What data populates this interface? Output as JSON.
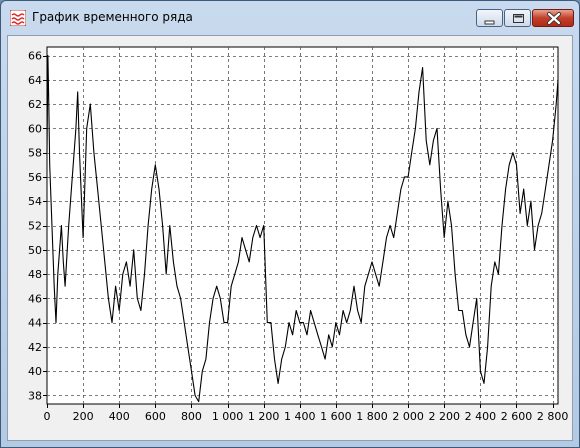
{
  "window": {
    "title": "График временного ряда",
    "icon": "wave-chart-icon",
    "controls": [
      "minimize-icon",
      "maximize-icon",
      "close-icon"
    ]
  },
  "chart_data": {
    "type": "line",
    "title": "",
    "xlabel": "",
    "ylabel": "",
    "xlim": [
      0,
      2830
    ],
    "ylim": [
      37.3,
      66.7
    ],
    "grid": true,
    "line_color": "#000000",
    "x_ticks": [
      0,
      200,
      400,
      600,
      800,
      1000,
      1200,
      1400,
      1600,
      1800,
      2000,
      2200,
      2400,
      2600,
      2800
    ],
    "x_tick_labels": [
      "0",
      "200",
      "400",
      "600",
      "800",
      "1 000",
      "1 200",
      "1 400",
      "1 600",
      "1 800",
      "2 000",
      "2 200",
      "2 400",
      "2 600",
      "2 800"
    ],
    "y_ticks": [
      38,
      40,
      42,
      44,
      46,
      48,
      50,
      52,
      54,
      56,
      58,
      60,
      62,
      64,
      66
    ],
    "y_tick_labels": [
      "38",
      "40",
      "42",
      "44",
      "46",
      "48",
      "50",
      "52",
      "54",
      "56",
      "58",
      "60",
      "62",
      "64",
      "66"
    ],
    "series": [
      {
        "x": [
          0,
          5,
          10,
          15,
          20,
          30,
          40,
          50,
          60,
          70,
          80,
          90,
          100,
          120,
          140,
          160,
          170,
          180,
          200,
          220,
          240,
          260,
          280,
          300,
          320,
          340,
          360,
          380,
          400,
          420,
          440,
          460,
          480,
          500,
          520,
          540,
          560,
          580,
          600,
          620,
          640,
          660,
          680,
          700,
          720,
          740,
          760,
          780,
          800,
          820,
          840,
          860,
          880,
          900,
          920,
          940,
          960,
          980,
          1000,
          1020,
          1040,
          1060,
          1080,
          1100,
          1120,
          1140,
          1160,
          1180,
          1200,
          1220,
          1240,
          1260,
          1280,
          1300,
          1320,
          1340,
          1360,
          1380,
          1400,
          1420,
          1440,
          1460,
          1480,
          1500,
          1520,
          1540,
          1560,
          1580,
          1600,
          1620,
          1640,
          1660,
          1680,
          1700,
          1720,
          1740,
          1760,
          1780,
          1800,
          1820,
          1840,
          1860,
          1880,
          1900,
          1920,
          1940,
          1960,
          1980,
          2000,
          2020,
          2040,
          2060,
          2080,
          2100,
          2120,
          2140,
          2160,
          2180,
          2200,
          2220,
          2240,
          2260,
          2280,
          2300,
          2320,
          2340,
          2360,
          2380,
          2400,
          2420,
          2440,
          2460,
          2480,
          2500,
          2520,
          2540,
          2560,
          2580,
          2600,
          2620,
          2640,
          2660,
          2680,
          2700,
          2720,
          2740,
          2760,
          2780,
          2800,
          2820,
          2830
        ],
        "y": [
          58,
          66,
          62,
          57,
          55,
          51,
          47,
          44,
          48,
          50,
          52,
          49,
          47,
          52,
          56,
          60,
          63,
          58,
          51,
          60,
          62,
          58,
          55,
          52,
          49,
          46,
          44,
          47,
          45,
          48,
          49,
          47,
          50,
          46,
          45,
          48,
          52,
          55,
          57,
          55,
          52,
          48,
          52,
          49,
          47,
          46,
          44,
          42,
          40,
          38,
          37.5,
          40,
          41,
          44,
          46,
          47,
          46,
          44,
          44,
          47,
          48,
          49,
          51,
          50,
          49,
          51,
          52,
          51,
          52,
          44,
          44,
          41,
          39,
          41,
          42,
          44,
          43,
          45,
          44,
          44,
          43,
          45,
          44,
          43,
          42,
          41,
          43,
          42,
          44,
          43,
          45,
          44,
          45,
          47,
          45,
          44,
          47,
          48,
          49,
          48,
          47,
          49,
          51,
          52,
          51,
          53,
          55,
          56,
          56,
          58,
          60,
          63,
          65,
          59,
          57,
          59,
          60,
          55,
          51,
          54,
          52,
          48,
          45,
          45,
          43,
          42,
          44,
          46,
          40,
          39,
          42,
          47,
          49,
          48,
          52,
          55,
          57,
          58,
          57,
          53,
          55,
          52,
          54,
          50,
          52,
          53,
          55,
          57,
          59,
          62,
          64
        ]
      }
    ]
  }
}
